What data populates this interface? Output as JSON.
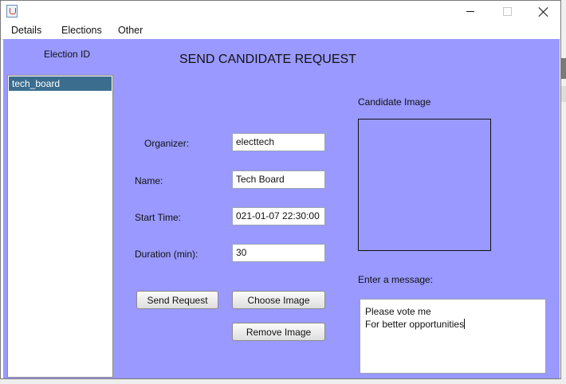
{
  "window": {
    "menu": [
      "Details",
      "Elections",
      "Other"
    ]
  },
  "election_id_label": "Election ID",
  "elections": [
    "tech_board"
  ],
  "page_title": "SEND CANDIDATE REQUEST",
  "form": {
    "organizer_label": "Organizer:",
    "organizer_value": "electtech",
    "name_label": "Name:",
    "name_value": "Tech Board",
    "start_time_label": "Start Time:",
    "start_time_value": "021-01-07 22:30:00",
    "duration_label": "Duration (min):",
    "duration_value": "30"
  },
  "buttons": {
    "send_request": "Send Request",
    "choose_image": "Choose Image",
    "remove_image": "Remove Image"
  },
  "candidate_image_label": "Candidate Image",
  "message": {
    "label": "Enter a message:",
    "lines": [
      "Please vote me",
      "For better opportunities"
    ]
  },
  "colors": {
    "panel_background": "#9999ff",
    "selection": "#3b6d8f"
  },
  "icons": [
    "java-app-icon",
    "minimize-icon",
    "maximize-icon",
    "close-icon"
  ]
}
